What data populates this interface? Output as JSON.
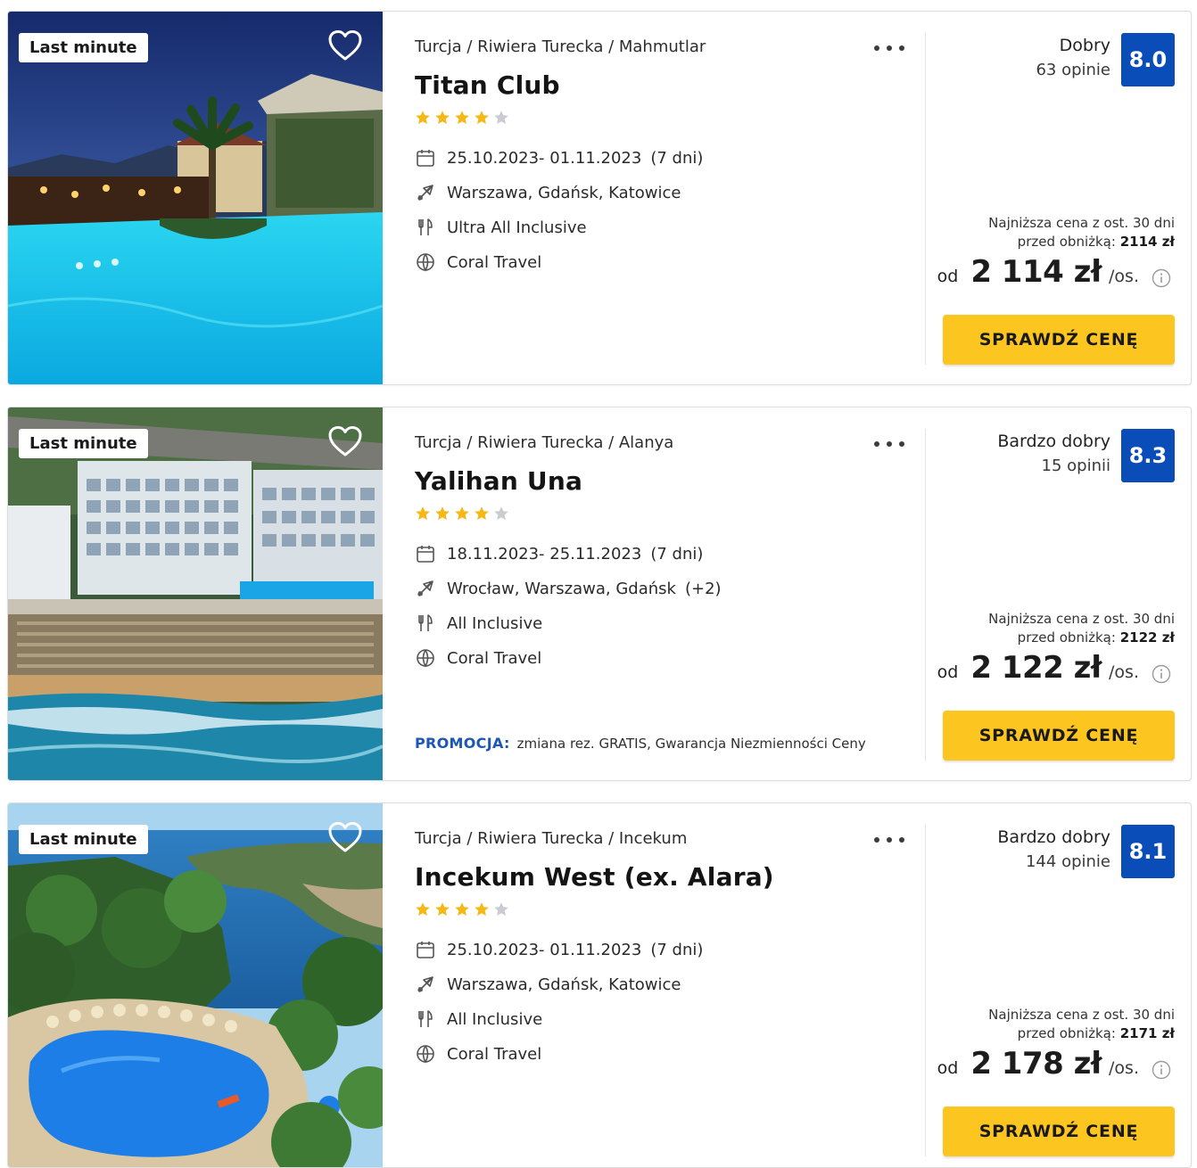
{
  "colors": {
    "score_bg": "#0b4db8",
    "cta_bg": "#fdc520",
    "star_filled": "#f5b917",
    "star_empty": "#c9ccd1",
    "promo_label": "#1c57b6"
  },
  "offers": [
    {
      "badge": "Last minute",
      "location": "Turcja / Riwiera Turecka / Mahmutlar",
      "name": "Titan Club",
      "stars_filled": 4,
      "stars_total": 5,
      "dates": "25.10.2023- 01.11.2023",
      "duration": "(7 dni)",
      "departures": "Warszawa, Gdańsk, Katowice",
      "departures_extra": "",
      "board": "Ultra All Inclusive",
      "operator": "Coral Travel",
      "promo_label": "",
      "promo_text": "",
      "rating_label": "Dobry",
      "rating_count": "63 opinie",
      "score": "8.0",
      "lowest_line1": "Najniższa cena z ost. 30 dni",
      "lowest_line2": "przed obniżką:",
      "lowest_value": "2114 zł",
      "price_prefix": "od",
      "price": "2 114 zł",
      "price_suffix": "/os.",
      "cta": "SPRAWDŹ CENĘ",
      "icons": {
        "dates": "calendar-icon",
        "departures": "plane-icon",
        "board": "cutlery-icon",
        "operator": "globe-icon"
      }
    },
    {
      "badge": "Last minute",
      "location": "Turcja / Riwiera Turecka / Alanya",
      "name": "Yalihan Una",
      "stars_filled": 4,
      "stars_total": 5,
      "dates": "18.11.2023- 25.11.2023",
      "duration": "(7 dni)",
      "departures": "Wrocław, Warszawa, Gdańsk",
      "departures_extra": "(+2)",
      "board": "All Inclusive",
      "operator": "Coral Travel",
      "promo_label": "PROMOCJA:",
      "promo_text": "zmiana rez. GRATIS, Gwarancja Niezmienności Ceny",
      "rating_label": "Bardzo dobry",
      "rating_count": "15 opinii",
      "score": "8.3",
      "lowest_line1": "Najniższa cena z ost. 30 dni",
      "lowest_line2": "przed obniżką:",
      "lowest_value": "2122 zł",
      "price_prefix": "od",
      "price": "2 122 zł",
      "price_suffix": "/os.",
      "cta": "SPRAWDŹ CENĘ",
      "icons": {
        "dates": "calendar-icon",
        "departures": "plane-icon",
        "board": "cutlery-icon",
        "operator": "globe-icon"
      }
    },
    {
      "badge": "Last minute",
      "location": "Turcja / Riwiera Turecka / Incekum",
      "name": "Incekum West (ex. Alara)",
      "stars_filled": 4,
      "stars_total": 5,
      "dates": "25.10.2023- 01.11.2023",
      "duration": "(7 dni)",
      "departures": "Warszawa, Gdańsk, Katowice",
      "departures_extra": "",
      "board": "All Inclusive",
      "operator": "Coral Travel",
      "promo_label": "",
      "promo_text": "",
      "rating_label": "Bardzo dobry",
      "rating_count": "144 opinie",
      "score": "8.1",
      "lowest_line1": "Najniższa cena z ost. 30 dni",
      "lowest_line2": "przed obniżką:",
      "lowest_value": "2171 zł",
      "price_prefix": "od",
      "price": "2 178 zł",
      "price_suffix": "/os.",
      "cta": "SPRAWDŹ CENĘ",
      "icons": {
        "dates": "calendar-icon",
        "departures": "plane-icon",
        "board": "cutlery-icon",
        "operator": "globe-icon"
      }
    }
  ]
}
